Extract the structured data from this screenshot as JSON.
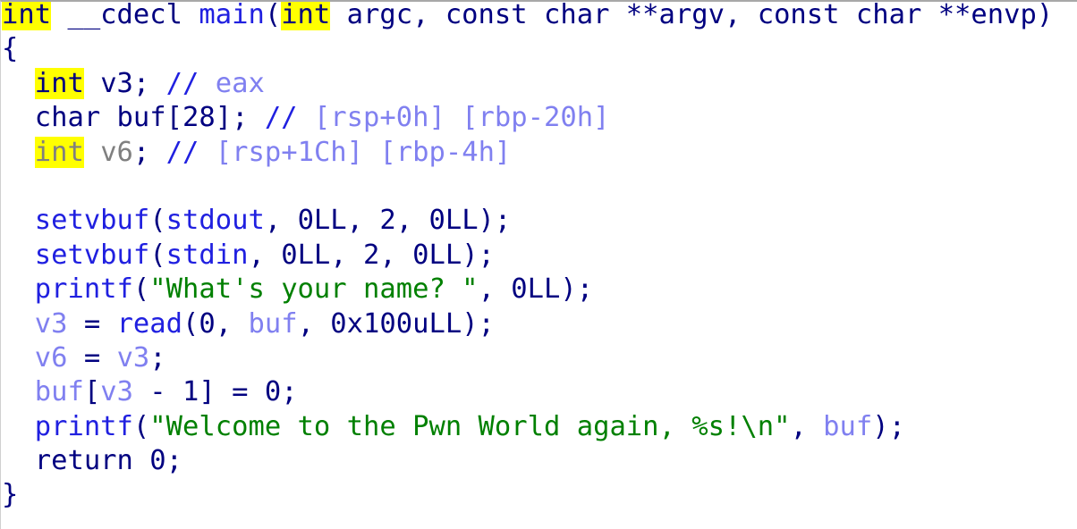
{
  "view": {
    "name": "hex-rays-pseudocode",
    "background_color": "#ffffff",
    "default_text_color": "#000080"
  },
  "colors": {
    "keyword": "#000080",
    "keyword_highlight_bg": "#ffff00",
    "unused_grey": "#808080",
    "function": "#2020e0",
    "local_variable": "#8080f0",
    "string": "#008000",
    "comment": "#8080f0",
    "punctuation": "#000080",
    "border": "#a8a8a8"
  },
  "code": {
    "language": "c",
    "function_name": "main",
    "lines": [
      {
        "n": 1,
        "text": "int __cdecl main(int argc, const char **argv, const char **envp)",
        "tokens": [
          {
            "t": "int",
            "c": "keyword"
          },
          {
            "t": " __cdecl ",
            "c": "punct"
          },
          {
            "t": "main",
            "c": "func"
          },
          {
            "t": "(",
            "c": "punct"
          },
          {
            "t": "int",
            "c": "keyword"
          },
          {
            "t": " argc, const char **argv, const char **envp)",
            "c": "punct"
          }
        ]
      },
      {
        "n": 2,
        "text": "{",
        "tokens": [
          {
            "t": "{",
            "c": "punct"
          }
        ]
      },
      {
        "n": 3,
        "text": "  int v3; // eax",
        "tokens": [
          {
            "t": "  ",
            "c": "punct"
          },
          {
            "t": "int",
            "c": "keyword"
          },
          {
            "t": " v3; ",
            "c": "punct"
          },
          {
            "t": "//",
            "c": "comment-slash"
          },
          {
            "t": " eax",
            "c": "comment"
          }
        ]
      },
      {
        "n": 4,
        "text": "  char buf[28]; // [rsp+0h] [rbp-20h]",
        "tokens": [
          {
            "t": "  char buf[28]; ",
            "c": "punct"
          },
          {
            "t": "//",
            "c": "comment-slash"
          },
          {
            "t": " [rsp+0h] [rbp-20h]",
            "c": "comment"
          }
        ]
      },
      {
        "n": 5,
        "text": "  int v6; // [rsp+1Ch] [rbp-4h]",
        "tokens": [
          {
            "t": "  ",
            "c": "punct"
          },
          {
            "t": "int",
            "c": "keyword-unused"
          },
          {
            "t": " v6",
            "c": "lvar-unused"
          },
          {
            "t": ";",
            "c": "punct"
          },
          {
            "t": " ",
            "c": "punct"
          },
          {
            "t": "//",
            "c": "comment-slash"
          },
          {
            "t": " [rsp+1Ch] [rbp-4h]",
            "c": "comment"
          }
        ]
      },
      {
        "n": 6,
        "text": "",
        "tokens": []
      },
      {
        "n": 7,
        "text": "  setvbuf(stdout, 0LL, 2, 0LL);",
        "tokens": [
          {
            "t": "  ",
            "c": "punct"
          },
          {
            "t": "setvbuf",
            "c": "libfunc"
          },
          {
            "t": "(",
            "c": "punct"
          },
          {
            "t": "stdout",
            "c": "global"
          },
          {
            "t": ", 0LL, 2, 0LL);",
            "c": "punct"
          }
        ]
      },
      {
        "n": 8,
        "text": "  setvbuf(stdin, 0LL, 2, 0LL);",
        "tokens": [
          {
            "t": "  ",
            "c": "punct"
          },
          {
            "t": "setvbuf",
            "c": "libfunc"
          },
          {
            "t": "(",
            "c": "punct"
          },
          {
            "t": "stdin",
            "c": "global"
          },
          {
            "t": ", 0LL, 2, 0LL);",
            "c": "punct"
          }
        ]
      },
      {
        "n": 9,
        "text": "  printf(\"What's your name? \", 0LL);",
        "tokens": [
          {
            "t": "  ",
            "c": "punct"
          },
          {
            "t": "printf",
            "c": "libfunc"
          },
          {
            "t": "(",
            "c": "punct"
          },
          {
            "t": "\"What's your name? \"",
            "c": "string"
          },
          {
            "t": ", 0LL);",
            "c": "punct"
          }
        ]
      },
      {
        "n": 10,
        "text": "  v3 = read(0, buf, 0x100uLL);",
        "tokens": [
          {
            "t": "  ",
            "c": "punct"
          },
          {
            "t": "v3",
            "c": "lvar"
          },
          {
            "t": " = ",
            "c": "punct"
          },
          {
            "t": "read",
            "c": "libfunc"
          },
          {
            "t": "(0, ",
            "c": "punct"
          },
          {
            "t": "buf",
            "c": "lvar"
          },
          {
            "t": ", 0x100uLL);",
            "c": "punct"
          }
        ]
      },
      {
        "n": 11,
        "text": "  v6 = v3;",
        "tokens": [
          {
            "t": "  ",
            "c": "punct"
          },
          {
            "t": "v6",
            "c": "lvar"
          },
          {
            "t": " = ",
            "c": "punct"
          },
          {
            "t": "v3",
            "c": "lvar"
          },
          {
            "t": ";",
            "c": "punct"
          }
        ]
      },
      {
        "n": 12,
        "text": "  buf[v3 - 1] = 0;",
        "tokens": [
          {
            "t": "  ",
            "c": "punct"
          },
          {
            "t": "buf",
            "c": "lvar"
          },
          {
            "t": "[",
            "c": "punct"
          },
          {
            "t": "v3",
            "c": "lvar"
          },
          {
            "t": " - 1] = 0;",
            "c": "punct"
          }
        ]
      },
      {
        "n": 13,
        "text": "  printf(\"Welcome to the Pwn World again, %s!\\n\", buf);",
        "tokens": [
          {
            "t": "  ",
            "c": "punct"
          },
          {
            "t": "printf",
            "c": "libfunc"
          },
          {
            "t": "(",
            "c": "punct"
          },
          {
            "t": "\"Welcome to the Pwn World again, %s!\\n\"",
            "c": "string"
          },
          {
            "t": ", ",
            "c": "punct"
          },
          {
            "t": "buf",
            "c": "lvar"
          },
          {
            "t": ");",
            "c": "punct"
          }
        ]
      },
      {
        "n": 14,
        "text": "  return 0;",
        "tokens": [
          {
            "t": "  return 0;",
            "c": "punct"
          }
        ]
      },
      {
        "n": 15,
        "text": "}",
        "tokens": [
          {
            "t": "}",
            "c": "punct"
          }
        ]
      }
    ]
  }
}
